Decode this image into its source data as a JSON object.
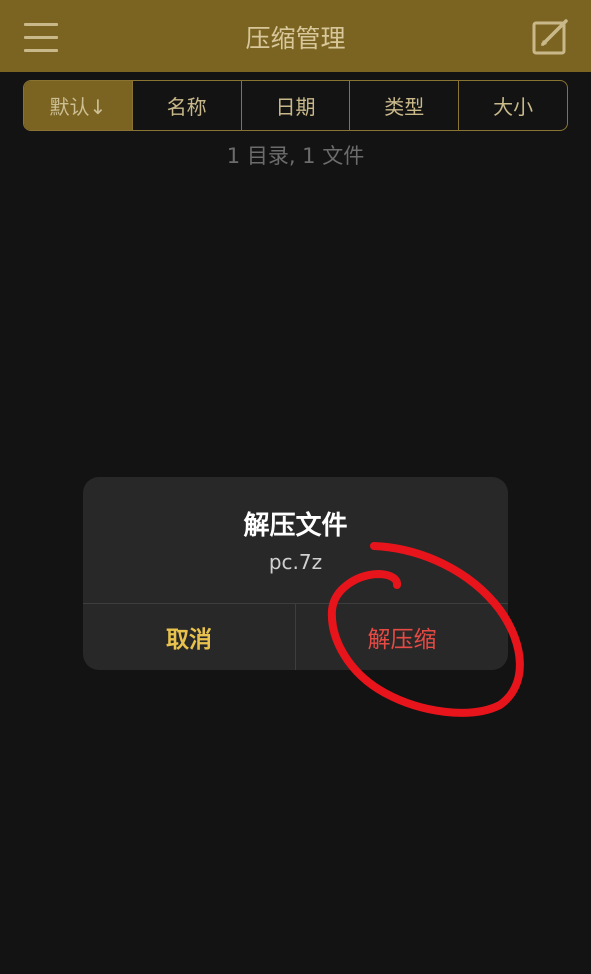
{
  "navbar": {
    "title": "压缩管理",
    "menu_icon": "hamburger-menu-icon",
    "compose_icon": "compose-edit-icon",
    "background_color": "#7b6422"
  },
  "sort_tabs": [
    {
      "label": "默认↓",
      "active": true
    },
    {
      "label": "名称",
      "active": false
    },
    {
      "label": "日期",
      "active": false
    },
    {
      "label": "类型",
      "active": false
    },
    {
      "label": "大小",
      "active": false
    }
  ],
  "summary": {
    "text": "1 目录, 1 文件"
  },
  "dialog": {
    "title": "解压文件",
    "message": "pc.7z",
    "cancel_label": "取消",
    "confirm_label": "解压缩",
    "cancel_color": "#e8c24c",
    "confirm_color": "#e64a45"
  },
  "annotation": {
    "shape": "hand-drawn-red-circle",
    "color": "#e8141b",
    "target": "confirm_button"
  }
}
